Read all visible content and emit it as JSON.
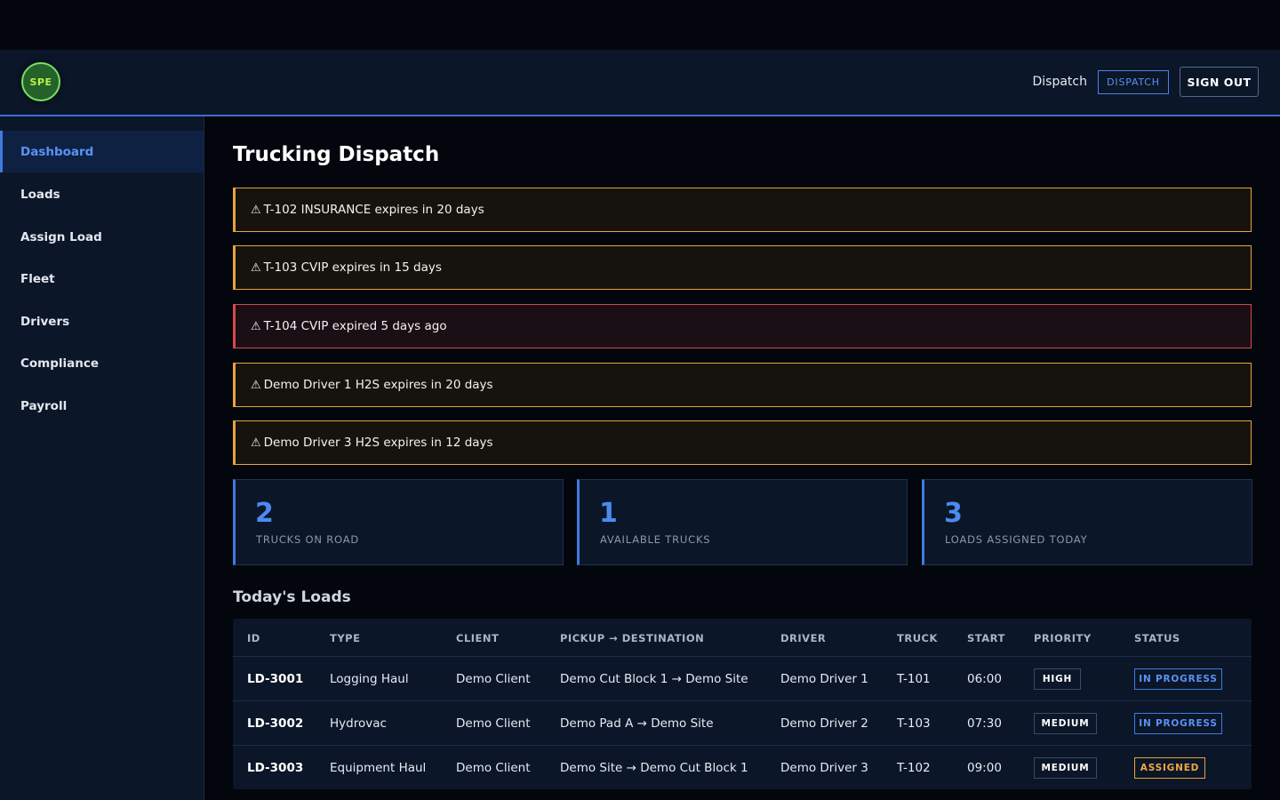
{
  "header": {
    "logo_text": "SPE",
    "role_label": "Dispatch",
    "role_badge": "DISPATCH",
    "signout_label": "SIGN OUT"
  },
  "sidebar": {
    "items": [
      {
        "label": "Dashboard",
        "active": true
      },
      {
        "label": "Loads"
      },
      {
        "label": "Assign Load"
      },
      {
        "label": "Fleet"
      },
      {
        "label": "Drivers"
      },
      {
        "label": "Compliance"
      },
      {
        "label": "Payroll"
      }
    ]
  },
  "main": {
    "title": "Trucking Dispatch",
    "alerts": [
      {
        "icon": "⚠",
        "text": "T-102 INSURANCE expires in 20 days",
        "level": "warning"
      },
      {
        "icon": "⚠",
        "text": "T-103 CVIP expires in 15 days",
        "level": "warning"
      },
      {
        "icon": "⚠",
        "text": "T-104 CVIP expired 5 days ago",
        "level": "danger"
      },
      {
        "icon": "⚠",
        "text": "Demo Driver 1 H2S expires in 20 days",
        "level": "warning"
      },
      {
        "icon": "⚠",
        "text": "Demo Driver 3 H2S expires in 12 days",
        "level": "warning"
      }
    ],
    "stats": [
      {
        "value": "2",
        "label": "TRUCKS ON ROAD"
      },
      {
        "value": "1",
        "label": "AVAILABLE TRUCKS"
      },
      {
        "value": "3",
        "label": "LOADS ASSIGNED TODAY"
      }
    ],
    "loads_title": "Today's Loads",
    "table": {
      "columns": [
        "ID",
        "TYPE",
        "CLIENT",
        "PICKUP → DESTINATION",
        "DRIVER",
        "TRUCK",
        "START",
        "PRIORITY",
        "STATUS"
      ],
      "rows": [
        {
          "id": "LD-3001",
          "type": "Logging Haul",
          "client": "Demo Client",
          "route": "Demo Cut Block 1 → Demo Site",
          "driver": "Demo Driver 1",
          "truck": "T-101",
          "start": "06:00",
          "priority": "HIGH",
          "status": "IN PROGRESS"
        },
        {
          "id": "LD-3002",
          "type": "Hydrovac",
          "client": "Demo Client",
          "route": "Demo Pad A → Demo Site",
          "driver": "Demo Driver 2",
          "truck": "T-103",
          "start": "07:30",
          "priority": "MEDIUM",
          "status": "IN PROGRESS"
        },
        {
          "id": "LD-3003",
          "type": "Equipment Haul",
          "client": "Demo Client",
          "route": "Demo Site → Demo Cut Block 1",
          "driver": "Demo Driver 3",
          "truck": "T-102",
          "start": "09:00",
          "priority": "MEDIUM",
          "status": "ASSIGNED"
        }
      ]
    }
  },
  "colors": {
    "accent": "#3f7be0",
    "warning": "#e8a33a",
    "danger": "#d9474f",
    "background": "#03060d",
    "panel": "#0b1628"
  },
  "icons": {
    "alert": "warning-triangle-icon"
  }
}
